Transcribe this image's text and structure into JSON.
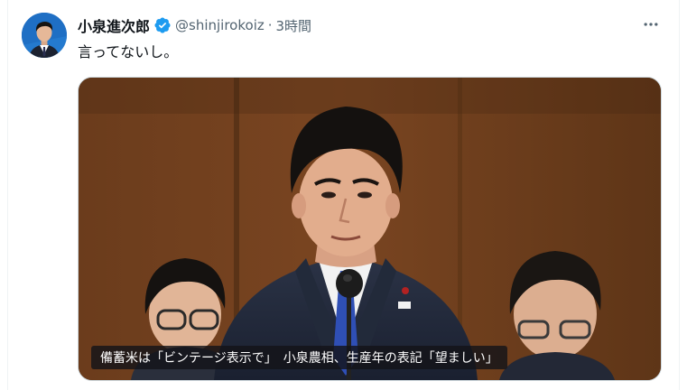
{
  "post": {
    "display_name": "小泉進次郎",
    "handle": "@shinjirokoiz",
    "separator": "·",
    "time": "3時間",
    "text": "言ってないし。"
  },
  "media": {
    "caption": "備蓄米は「ビンテージ表示で」　小泉農相、生産年の表記「望ましい」"
  },
  "icons": {
    "verified": "verified-badge-icon",
    "more": "more-horizontal-icon"
  },
  "colors": {
    "verified_blue": "#1d9bf0",
    "secondary_text": "#536471",
    "primary_text": "#0f1419"
  }
}
